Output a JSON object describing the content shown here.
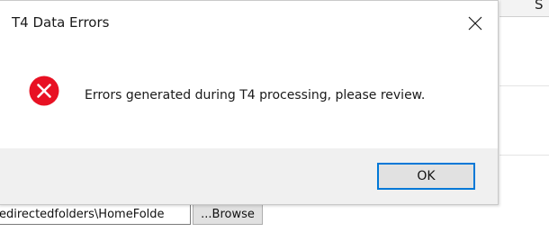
{
  "dialog": {
    "title": "T4 Data Errors",
    "message": "Errors generated during T4 processing, please review.",
    "ok_label": "OK",
    "icon": "error-icon",
    "close_icon": "close-icon"
  },
  "background": {
    "header_column_text": "S",
    "path_field_value": "edirectedfolders\\HomeFolde",
    "browse_label": "...Browse"
  },
  "colors": {
    "error_red": "#e81123",
    "focus_blue": "#0078d7",
    "footer_gray": "#f0f0f0"
  }
}
